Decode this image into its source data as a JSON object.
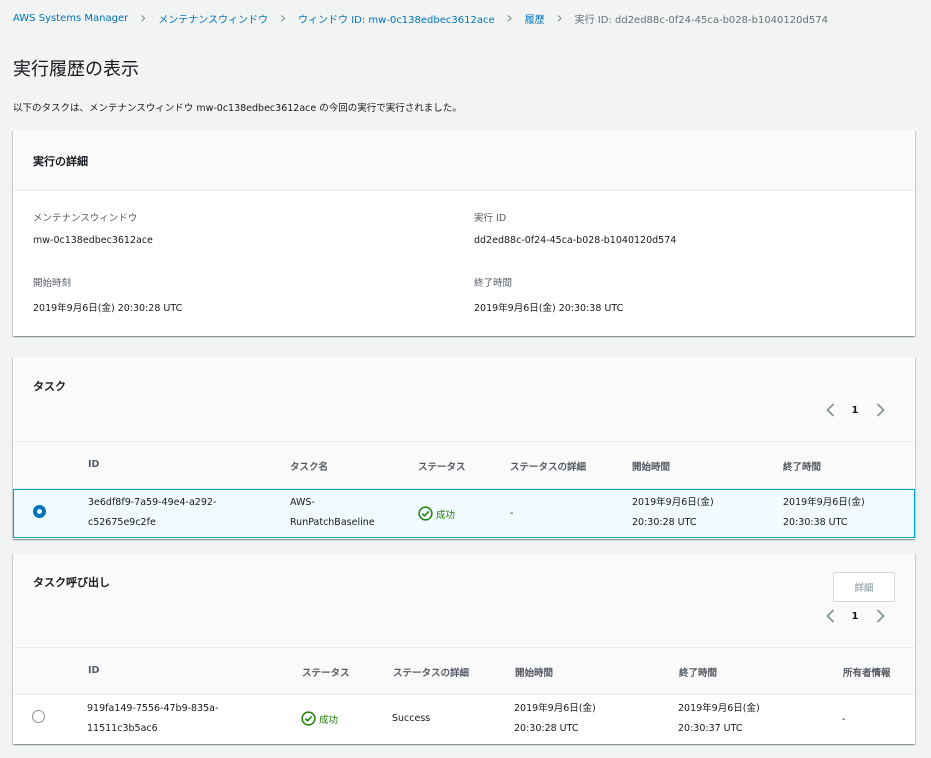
{
  "breadcrumb": {
    "items": [
      "AWS Systems Manager",
      "メンテナンスウィンドウ",
      "ウィンドウ ID: mw-0c138edbec3612ace",
      "履歴",
      "実行 ID: dd2ed88c-0f24-45ca-b028-b1040120d574"
    ]
  },
  "page": {
    "title": "実行履歴の表示",
    "description": "以下のタスクは、メンテナンスウィンドウ mw-0c138edbec3612ace の今回の実行で実行されました。"
  },
  "details": {
    "title": "実行の詳細",
    "window_label": "メンテナンスウィンドウ",
    "window_value": "mw-0c138edbec3612ace",
    "exec_id_label": "実行 ID",
    "exec_id_value": "dd2ed88c-0f24-45ca-b028-b1040120d574",
    "start_label": "開始時刻",
    "start_value": "2019年9月6日(金) 20:30:28 UTC",
    "end_label": "終了時間",
    "end_value": "2019年9月6日(金) 20:30:38 UTC"
  },
  "tasks": {
    "title": "タスク",
    "page": "1",
    "columns": [
      "ID",
      "タスク名",
      "ステータス",
      "ステータスの詳細",
      "開始時間",
      "終了時間"
    ],
    "rows": [
      {
        "id_line1": "3e6df8f9-7a59-49e4-a292-",
        "id_line2": "c52675e9c2fe",
        "name_line1": "AWS-",
        "name_line2": "RunPatchBaseline",
        "status": "成功",
        "status_detail": "-",
        "start_line1": "2019年9月6日(金)",
        "start_line2": "20:30:28 UTC",
        "end_line1": "2019年9月6日(金)",
        "end_line2": "20:30:38 UTC",
        "selected": true
      }
    ]
  },
  "invocations": {
    "title": "タスク呼び出し",
    "details_button": "詳細",
    "page": "1",
    "columns": [
      "ID",
      "ステータス",
      "ステータスの詳細",
      "開始時間",
      "終了時間",
      "所有者情報"
    ],
    "rows": [
      {
        "id_line1": "919fa149-7556-47b9-835a-",
        "id_line2": "11511c3b5ac6",
        "status": "成功",
        "status_detail": "Success",
        "start_line1": "2019年9月6日(金)",
        "start_line2": "20:30:28 UTC",
        "end_line1": "2019年9月6日(金)",
        "end_line2": "20:30:37 UTC",
        "owner": "-",
        "selected": false
      }
    ]
  },
  "colors": {
    "link": "#0073bb",
    "success": "#1d8102",
    "selected_row_bg": "#f1faff",
    "selected_row_border": "#00a1c9"
  }
}
